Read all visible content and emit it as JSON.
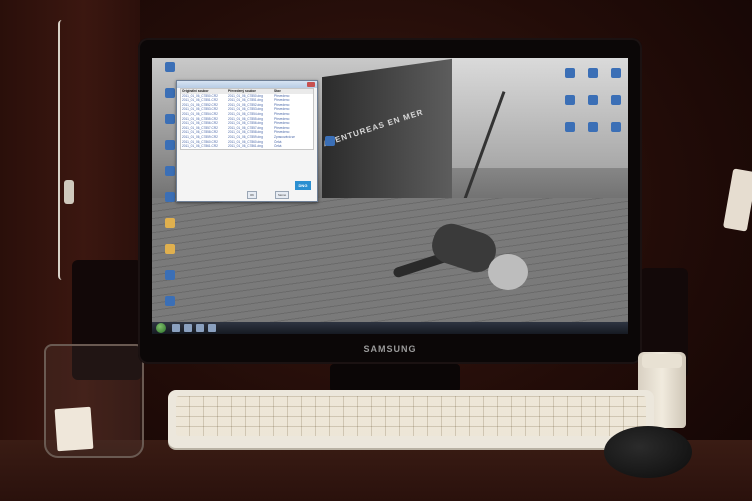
{
  "monitor": {
    "brand": "SAMSUNG"
  },
  "boat": {
    "hull_text": "AVENTUREAS EN MER"
  },
  "dialog": {
    "title": "",
    "columns": [
      "Originální soubor",
      "Převedený soubor",
      "Stav"
    ],
    "rows": [
      [
        "2011_01_06_C7850.CR2",
        "2011_01_06_C7850.dng",
        "Převedeno"
      ],
      [
        "2011_01_06_C7851.CR2",
        "2011_01_06_C7851.dng",
        "Převedeno"
      ],
      [
        "2011_01_06_C7852.CR2",
        "2011_01_06_C7852.dng",
        "Převedeno"
      ],
      [
        "2011_01_06_C7853.CR2",
        "2011_01_06_C7853.dng",
        "Převedeno"
      ],
      [
        "2011_01_06_C7854.CR2",
        "2011_01_06_C7854.dng",
        "Převedeno"
      ],
      [
        "2011_01_06_C7855.CR2",
        "2011_01_06_C7855.dng",
        "Převedeno"
      ],
      [
        "2011_01_06_C7856.CR2",
        "2011_01_06_C7856.dng",
        "Převedeno"
      ],
      [
        "2011_01_06_C7857.CR2",
        "2011_01_06_C7857.dng",
        "Převedeno"
      ],
      [
        "2011_01_06_C7858.CR2",
        "2011_01_06_C7858.dng",
        "Převedeno"
      ],
      [
        "2011_01_06_C7859.CR2",
        "2011_01_06_C7859.dng",
        "Zpracovává se"
      ],
      [
        "2011_01_06_C7860.CR2",
        "2011_01_06_C7860.dng",
        "Čeká"
      ],
      [
        "2011_01_06_C7861.CR2",
        "2011_01_06_C7861.dng",
        "Čeká"
      ]
    ],
    "badge": "DNG",
    "ok_button": "OK",
    "cancel_button": "Storno"
  },
  "colors": {
    "icon_blue": "#3b6fb6",
    "folder": "#e0b04e",
    "dng_badge": "#2b8fd1"
  }
}
